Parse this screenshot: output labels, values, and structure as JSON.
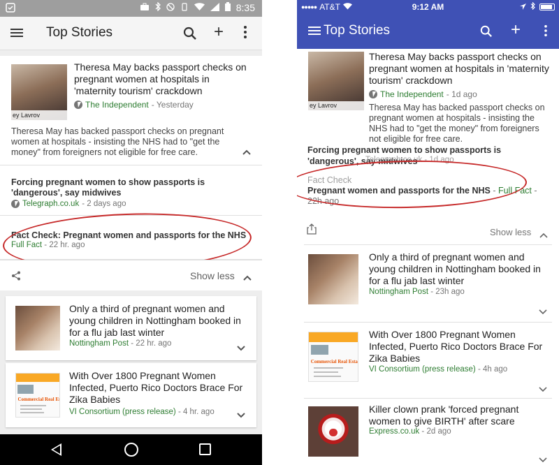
{
  "android": {
    "status_time": "8:35",
    "appbar_title": "Top Stories",
    "main_story": {
      "headline": "Theresa May backs passport checks on pregnant women at hospitals in 'maternity tourism' crackdown",
      "thumb_caption": "ey Lavrov",
      "source": "The Independent",
      "age": " - Yesterday",
      "snippet": "Theresa May has backed passport checks on pregnant women at hospitals - insisting the NHS had to \"get the money\" from foreigners not eligible for free care."
    },
    "related": {
      "headline": "Forcing pregnant women to show passports is 'dangerous', say midwives",
      "source": "Telegraph.co.uk",
      "age": " - 2 days ago"
    },
    "fact_check": {
      "headline": "Fact Check: Pregnant women and passports for the NHS",
      "source": "Full Fact",
      "age": " - 22 hr. ago"
    },
    "show_less": "Show less",
    "cards": [
      {
        "headline": "Only a third of pregnant women and young children in Nottingham booked in for a flu jab last winter",
        "source": "Nottingham Post",
        "age": " - 22 hr. ago"
      },
      {
        "headline": "With Over 1800 Pregnant Women Infected, Puerto Rico Doctors Brace For Zika Babies",
        "source": "VI Consortium (press release)",
        "age": " - 4 hr. ago"
      }
    ],
    "real_estate_text": "Commercial Real Estate"
  },
  "ios": {
    "carrier": "AT&T",
    "status_time": "9:12 AM",
    "appbar_title": "Top Stories",
    "main_story": {
      "headline": "Theresa May backs passport checks on pregnant women at hospitals in 'maternity tourism' crackdown",
      "thumb_caption": "ey Lavrov",
      "source": "The Independent",
      "age": " - 1d ago",
      "snippet": "Theresa May has backed passport checks on pregnant women at hospitals - insisting the NHS had to \"get the money\" from foreigners not eligible for free care."
    },
    "related": {
      "headline": "Forcing pregnant women to show passports is 'dangerous', say midwives",
      "overlap": "Telegraph.co.uk - 1d ago"
    },
    "fact_check": {
      "label": "Fact Check",
      "headline": "Pregnant women and passports for the NHS",
      "source": "Full Fact",
      "age": "22h ago"
    },
    "show_less": "Show less",
    "cards": [
      {
        "headline": "Only a third of pregnant women and young children in Nottingham booked in for a flu jab last winter",
        "source": "Nottingham Post",
        "age": " - 23h ago"
      },
      {
        "headline": "With Over 1800 Pregnant Women Infected, Puerto Rico Doctors Brace For Zika Babies",
        "source": "VI Consortium (press release)",
        "age": " - 4h ago"
      },
      {
        "headline": "Killer clown prank 'forced pregnant women to give BIRTH' after scare",
        "source": "Express.co.uk",
        "age": " - 2d ago"
      }
    ],
    "real_estate_text": "Commercial Real Estate"
  },
  "colors": {
    "ios_header": "#3f51b5",
    "source_green": "#2e7d32",
    "annotation_red": "#c62828"
  }
}
